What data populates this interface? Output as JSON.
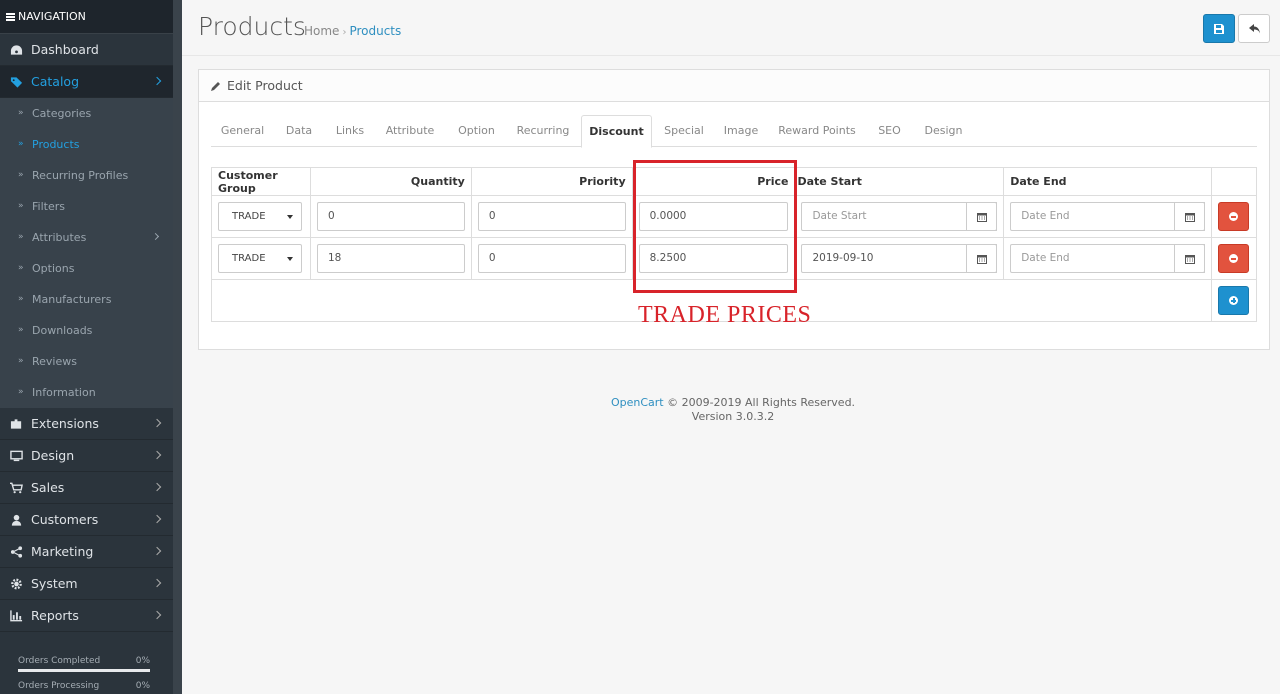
{
  "sidebar": {
    "title": "NAVIGATION",
    "items": [
      {
        "label": "Dashboard",
        "icon": "dashboard-icon"
      },
      {
        "label": "Catalog",
        "icon": "tags-icon",
        "active": true
      },
      {
        "label": "Extensions",
        "icon": "puzzle-icon"
      },
      {
        "label": "Design",
        "icon": "desktop-icon"
      },
      {
        "label": "Sales",
        "icon": "cart-icon"
      },
      {
        "label": "Customers",
        "icon": "user-icon"
      },
      {
        "label": "Marketing",
        "icon": "share-icon"
      },
      {
        "label": "System",
        "icon": "cog-icon"
      },
      {
        "label": "Reports",
        "icon": "bar-chart-icon"
      }
    ],
    "catalog_sub": [
      "Categories",
      "Products",
      "Recurring Profiles",
      "Filters",
      "Attributes",
      "Options",
      "Manufacturers",
      "Downloads",
      "Reviews",
      "Information"
    ],
    "progress": [
      {
        "label": "Orders Completed",
        "pct": "0%"
      },
      {
        "label": "Orders Processing",
        "pct": "0%"
      }
    ]
  },
  "header": {
    "title": "Products",
    "breadcrumb": [
      "Home",
      "Products"
    ]
  },
  "panel": {
    "title": "Edit Product",
    "tabs": [
      "General",
      "Data",
      "Links",
      "Attribute",
      "Option",
      "Recurring",
      "Discount",
      "Special",
      "Image",
      "Reward Points",
      "SEO",
      "Design"
    ],
    "active_tab": "Discount"
  },
  "table": {
    "headers": {
      "group": "Customer Group",
      "quantity": "Quantity",
      "priority": "Priority",
      "price": "Price",
      "date_start": "Date Start",
      "date_end": "Date End"
    },
    "placeholders": {
      "date_start": "Date Start",
      "date_end": "Date End"
    },
    "rows": [
      {
        "group": "TRADE",
        "quantity": "0",
        "priority": "0",
        "price": "0.0000",
        "date_start": "",
        "date_end": ""
      },
      {
        "group": "TRADE",
        "quantity": "18",
        "priority": "0",
        "price": "8.2500",
        "date_start": "2019-09-10",
        "date_end": ""
      }
    ]
  },
  "annotation": "TRADE PRICES",
  "footer": {
    "brand": "OpenCart",
    "copyright": "© 2009-2019 All Rights Reserved.",
    "version": "Version 3.0.3.2"
  },
  "colors": {
    "primary": "#1e91cf",
    "danger": "#e2533e",
    "annotation": "#d8232a",
    "sidebar": "#2b343c"
  }
}
